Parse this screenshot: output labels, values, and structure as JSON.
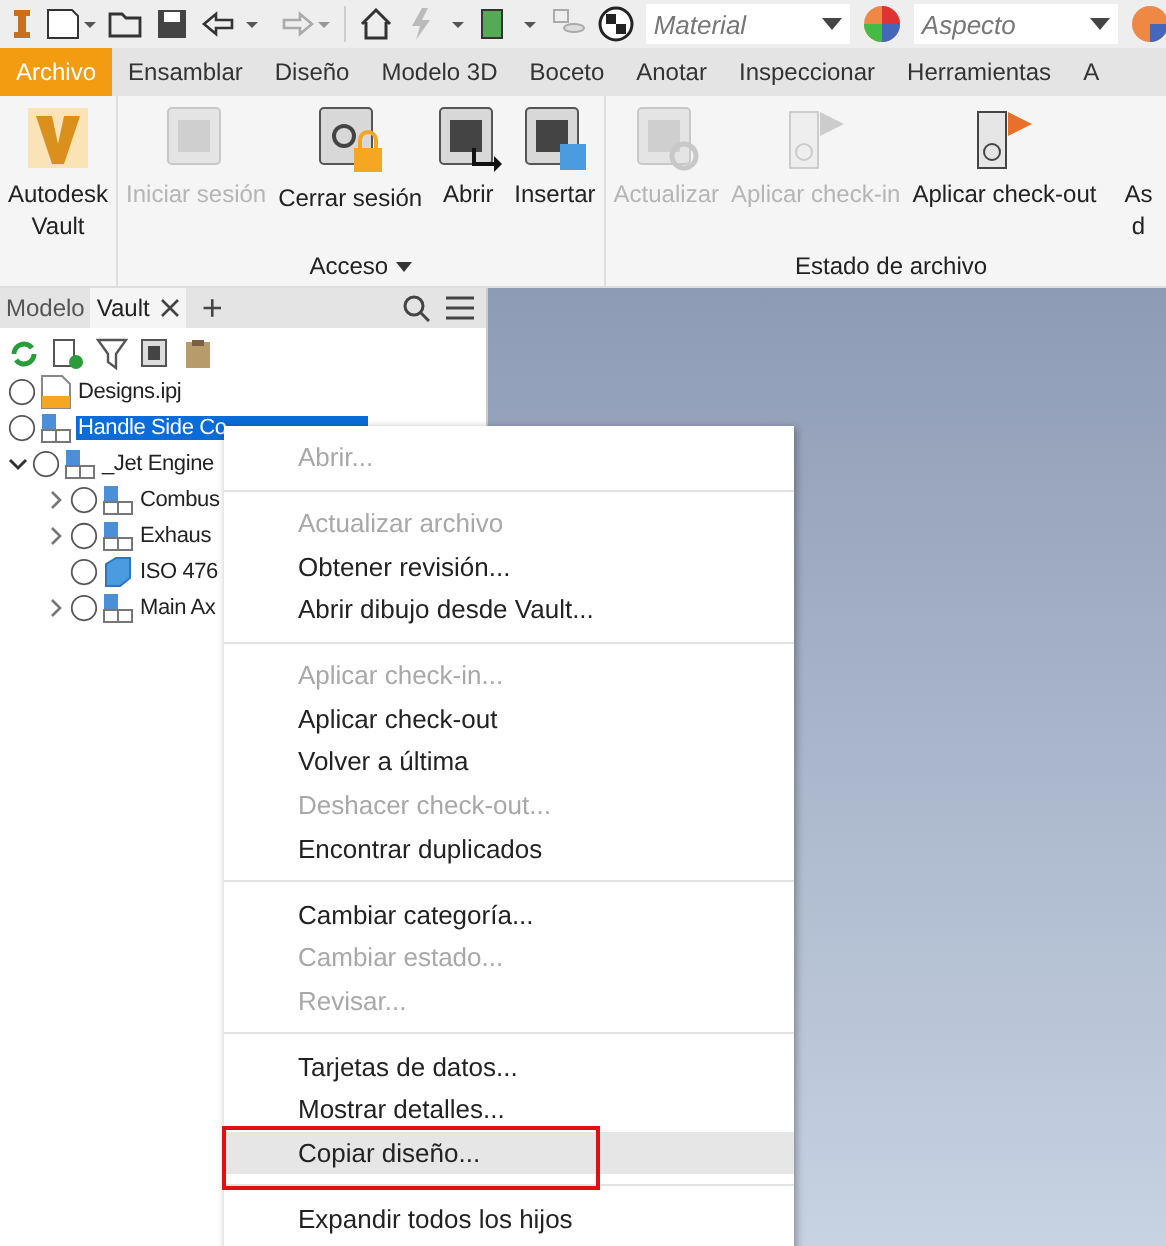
{
  "quick_access": {
    "material": "Material",
    "appearance": "Aspecto"
  },
  "ribbon_tabs": [
    {
      "label": "Archivo",
      "selected": true
    },
    {
      "label": "Ensamblar",
      "selected": false
    },
    {
      "label": "Diseño",
      "selected": false
    },
    {
      "label": "Modelo 3D",
      "selected": false
    },
    {
      "label": "Boceto",
      "selected": false
    },
    {
      "label": "Anotar",
      "selected": false
    },
    {
      "label": "Inspeccionar",
      "selected": false
    },
    {
      "label": "Herramientas",
      "selected": false
    },
    {
      "label": "A",
      "selected": false
    }
  ],
  "ribbon_panels": [
    {
      "buttons": [
        {
          "kind": "vault",
          "lines": [
            "Autodesk",
            "Vault"
          ],
          "disabled": false
        }
      ]
    },
    {
      "title": "Acceso",
      "dropdown": true,
      "buttons": [
        {
          "kind": "login",
          "lines": [
            "Iniciar sesión"
          ],
          "disabled": true
        },
        {
          "kind": "logout",
          "lines": [
            "Cerrar sesión"
          ],
          "disabled": false
        },
        {
          "kind": "open",
          "lines": [
            "Abrir"
          ],
          "disabled": false
        },
        {
          "kind": "insert",
          "lines": [
            "Insertar"
          ],
          "disabled": false
        }
      ]
    },
    {
      "title": "Estado de archivo",
      "buttons": [
        {
          "kind": "refresh",
          "lines": [
            "Actualizar"
          ],
          "disabled": true
        },
        {
          "kind": "checkin",
          "lines": [
            "Aplicar check-in"
          ],
          "disabled": true
        },
        {
          "kind": "checkout",
          "lines": [
            "Aplicar check-out"
          ],
          "disabled": false
        },
        {
          "kind": "other",
          "lines": [
            "As",
            "d"
          ],
          "disabled": false
        }
      ]
    }
  ],
  "browser": {
    "tabs": [
      {
        "label": "Modelo",
        "selected": false
      },
      {
        "label": "Vault",
        "selected": true,
        "closable": true
      }
    ],
    "add": "+",
    "tree": [
      {
        "label": "Designs.ipj",
        "kind": "project",
        "selected": false
      },
      {
        "label": "Handle Side Co",
        "kind": "assembly",
        "selected": true
      },
      {
        "label": "_Jet Engine",
        "kind": "assembly",
        "selected": false,
        "expanded": true,
        "children": [
          {
            "label": "Combus",
            "kind": "assembly",
            "selected": false,
            "expanded": false
          },
          {
            "label": "Exhaus",
            "kind": "assembly",
            "selected": false,
            "expanded": false
          },
          {
            "label": "ISO 476",
            "kind": "part",
            "selected": false
          },
          {
            "label": "Main Ax",
            "kind": "assembly",
            "selected": false,
            "expanded": false
          }
        ]
      }
    ]
  },
  "context_menu": {
    "groups": [
      [
        {
          "label": "Abrir...",
          "disabled": true,
          "selected": false
        }
      ],
      [
        {
          "label": "Actualizar archivo",
          "disabled": true,
          "selected": false
        },
        {
          "label": "Obtener revisión...",
          "disabled": false,
          "selected": false
        },
        {
          "label": "Abrir dibujo desde Vault...",
          "disabled": false,
          "selected": false
        }
      ],
      [
        {
          "label": "Aplicar check-in...",
          "disabled": true,
          "selected": false
        },
        {
          "label": "Aplicar check-out",
          "disabled": false,
          "selected": false
        },
        {
          "label": "Volver a última",
          "disabled": false,
          "selected": false
        },
        {
          "label": "Deshacer check-out...",
          "disabled": true,
          "selected": false
        },
        {
          "label": "Encontrar duplicados",
          "disabled": false,
          "selected": false
        }
      ],
      [
        {
          "label": "Cambiar categoría...",
          "disabled": false,
          "selected": false
        },
        {
          "label": "Cambiar estado...",
          "disabled": true,
          "selected": false
        },
        {
          "label": "Revisar...",
          "disabled": true,
          "selected": false
        }
      ],
      [
        {
          "label": "Tarjetas de datos...",
          "disabled": false,
          "selected": false
        },
        {
          "label": "Mostrar detalles...",
          "disabled": false,
          "selected": false
        },
        {
          "label": "Copiar diseño...",
          "disabled": false,
          "selected": true,
          "marked": true
        }
      ],
      [
        {
          "label": "Expandir todos los hijos",
          "disabled": false,
          "selected": false
        }
      ]
    ]
  }
}
